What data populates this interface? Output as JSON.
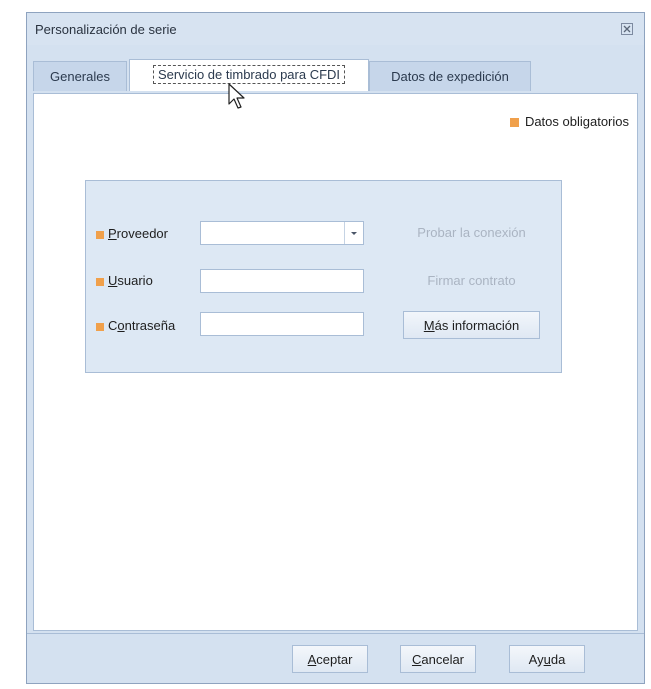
{
  "window": {
    "title": "Personalización de serie",
    "close_icon": "close-icon"
  },
  "tabs": [
    {
      "label": "Generales",
      "active": false
    },
    {
      "label": "Servicio de timbrado para CFDI",
      "active": true
    },
    {
      "label": "Datos de expedición",
      "active": false
    }
  ],
  "legend": {
    "label": "Datos obligatorios",
    "color": "#f0a04b"
  },
  "form": {
    "proveedor": {
      "mnemonic": "P",
      "rest": "roveedor",
      "value": ""
    },
    "usuario": {
      "mnemonic": "U",
      "rest": "suario",
      "value": ""
    },
    "contrasena": {
      "pre": "C",
      "mnemonic": "o",
      "rest": "ntraseña",
      "value": ""
    }
  },
  "side_buttons": {
    "probar": "Probar la conexión",
    "firmar": "Firmar contrato",
    "mas_info_mnemonic": "M",
    "mas_info_rest": "ás información"
  },
  "footer": {
    "aceptar_mnemonic": "A",
    "aceptar_rest": "ceptar",
    "cancelar_mnemonic": "C",
    "cancelar_rest": "ancelar",
    "ayuda_pre": "Ay",
    "ayuda_mnemonic": "u",
    "ayuda_rest": "da"
  },
  "colors": {
    "required_marker": "#f0a04b",
    "window_bg": "#d4e1f0",
    "group_bg": "#dde8f4"
  }
}
